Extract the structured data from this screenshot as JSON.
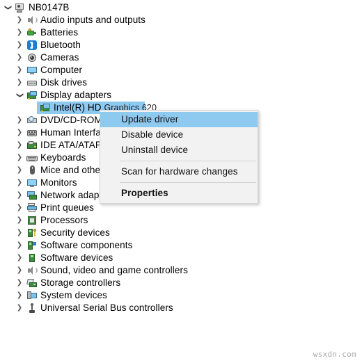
{
  "window": {
    "background_color": "#ffffff",
    "selection_color": "#8ec9f0",
    "menu_background": "#f2f2f2",
    "menu_border": "#d6d6d6"
  },
  "tree": {
    "root": {
      "label": "NB0147B",
      "icon": "computer-icon",
      "expanded": true
    },
    "items": [
      {
        "label": "Audio inputs and outputs",
        "icon": "speaker-icon",
        "expanded": false,
        "depth": 1
      },
      {
        "label": "Batteries",
        "icon": "battery-icon",
        "expanded": false,
        "depth": 1
      },
      {
        "label": "Bluetooth",
        "icon": "bluetooth-icon",
        "expanded": false,
        "depth": 1
      },
      {
        "label": "Cameras",
        "icon": "camera-icon",
        "expanded": false,
        "depth": 1
      },
      {
        "label": "Computer",
        "icon": "monitor-icon",
        "expanded": false,
        "depth": 1
      },
      {
        "label": "Disk drives",
        "icon": "disk-drive-icon",
        "expanded": false,
        "depth": 1
      },
      {
        "label": "Display adapters",
        "icon": "display-adapter-icon",
        "expanded": true,
        "depth": 1
      },
      {
        "label": "Intel(R) HD ",
        "label_tail": "Graphics 620",
        "icon": "display-adapter-icon",
        "depth": 2,
        "selected": true
      },
      {
        "label": "DVD/CD-ROM d",
        "icon": "dvd-drive-icon",
        "expanded": false,
        "depth": 1,
        "clipped": true
      },
      {
        "label": "Human Interfac",
        "icon": "human-interface-icon",
        "expanded": false,
        "depth": 1,
        "clipped": true
      },
      {
        "label": "IDE ATA/ATAPI c",
        "icon": "ide-controller-icon",
        "expanded": false,
        "depth": 1,
        "clipped": true
      },
      {
        "label": "Keyboards",
        "icon": "keyboard-icon",
        "expanded": false,
        "depth": 1
      },
      {
        "label": "Mice and other",
        "icon": "mouse-icon",
        "expanded": false,
        "depth": 1,
        "clipped": true
      },
      {
        "label": "Monitors",
        "icon": "monitor-icon",
        "expanded": false,
        "depth": 1
      },
      {
        "label": "Network adapte",
        "icon": "network-adapter-icon",
        "expanded": false,
        "depth": 1,
        "clipped": true
      },
      {
        "label": "Print queues",
        "icon": "printer-icon",
        "expanded": false,
        "depth": 1
      },
      {
        "label": "Processors",
        "icon": "processor-icon",
        "expanded": false,
        "depth": 1
      },
      {
        "label": "Security devices",
        "icon": "security-device-icon",
        "expanded": false,
        "depth": 1
      },
      {
        "label": "Software components",
        "icon": "software-component-icon",
        "expanded": false,
        "depth": 1
      },
      {
        "label": "Software devices",
        "icon": "software-device-icon",
        "expanded": false,
        "depth": 1
      },
      {
        "label": "Sound, video and game controllers",
        "icon": "speaker-icon",
        "expanded": false,
        "depth": 1
      },
      {
        "label": "Storage controllers",
        "icon": "storage-controller-icon",
        "expanded": false,
        "depth": 1
      },
      {
        "label": "System devices",
        "icon": "system-device-icon",
        "expanded": false,
        "depth": 1
      },
      {
        "label": "Universal Serial Bus controllers",
        "icon": "usb-controller-icon",
        "expanded": false,
        "depth": 1
      }
    ]
  },
  "context_menu": {
    "items": [
      {
        "label": "Update driver",
        "highlighted": true,
        "bold": false
      },
      {
        "label": "Disable device",
        "highlighted": false,
        "bold": false
      },
      {
        "label": "Uninstall device",
        "highlighted": false,
        "bold": false
      },
      {
        "separator_after": true
      },
      {
        "label": "Scan for hardware changes",
        "highlighted": false,
        "bold": false
      },
      {
        "separator_after": true
      },
      {
        "label": "Properties",
        "highlighted": false,
        "bold": true
      }
    ]
  },
  "watermark": {
    "text": "wsxdn.com"
  }
}
